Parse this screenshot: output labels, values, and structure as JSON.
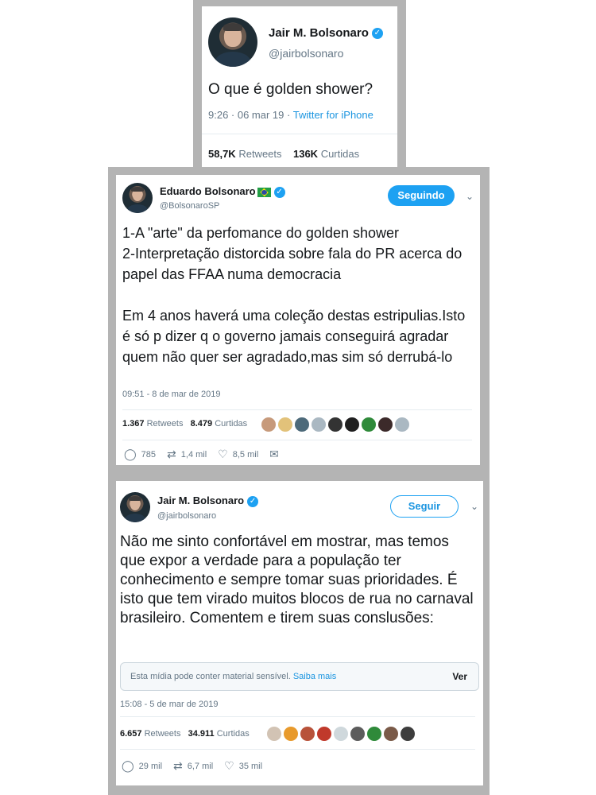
{
  "tweet1": {
    "name": "Jair M. Bolsonaro",
    "handle": "@jairbolsonaro",
    "text": "O que é golden shower?",
    "time": "9:26 · 06 mar 19",
    "separator": " · ",
    "source": "Twitter for iPhone",
    "retweets_count": "58,7K",
    "retweets_label": "Retweets",
    "likes_count": "136K",
    "likes_label": "Curtidas"
  },
  "tweet2": {
    "name": "Eduardo Bolsonaro",
    "handle": "@BolsonaroSP",
    "follow_button": "Seguindo",
    "text": "1-A \"arte\" da perfomance do golden shower\n2-Interpretação distorcida sobre fala do PR acerca do papel das FFAA numa democracia\n\nEm 4 anos haverá uma coleção destas estripulias.Isto é só p dizer q o governo jamais conseguirá agradar quem não quer ser agradado,mas sim só derrubá-lo",
    "time": "09:51 - 8 de mar de 2019",
    "retweets_count": "1.367",
    "retweets_label": "Retweets",
    "likes_count": "8.479",
    "likes_label": "Curtidas",
    "replies": "785",
    "retweets_short": "1,4 mil",
    "likes_short": "8,5 mil"
  },
  "tweet3": {
    "name": "Jair M. Bolsonaro",
    "handle": "@jairbolsonaro",
    "follow_button": "Seguir",
    "text": "Não me sinto confortável em mostrar, mas temos que expor a verdade para a população ter conhecimento e sempre tomar suas prioridades. É isto que tem virado muitos blocos de rua no carnaval brasileiro. Comentem e tirem suas conslusões:",
    "sensitive_message": "Esta mídia pode conter material sensível.",
    "sensitive_link": "Saiba mais",
    "sensitive_view": "Ver",
    "time": "15:08 - 5 de mar de 2019",
    "retweets_count": "6.657",
    "retweets_label": "Retweets",
    "likes_count": "34.911",
    "likes_label": "Curtidas",
    "replies": "29 mil",
    "retweets_short": "6,7 mil",
    "likes_short": "35 mil"
  },
  "icons": {
    "verified": "verified-badge-icon",
    "reply": "reply-icon",
    "retweet": "retweet-icon",
    "like": "heart-icon",
    "message": "direct-message-icon",
    "chevron": "chevron-down-icon",
    "flag": "brazil-flag-icon"
  },
  "colors": {
    "accent": "#1da1f2",
    "link": "#1b95e0",
    "secondary_text": "#657786",
    "frame": "#b4b4b4"
  }
}
